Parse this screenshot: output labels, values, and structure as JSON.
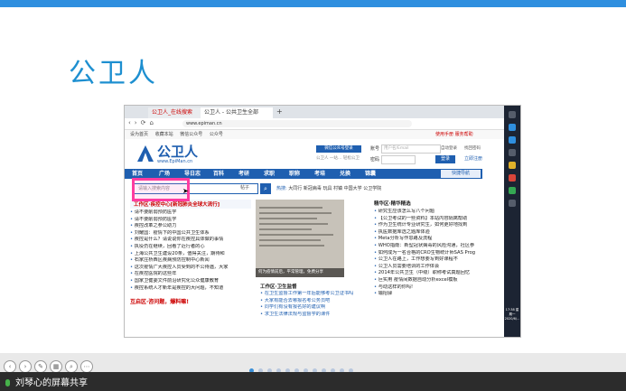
{
  "slide": {
    "title": "公卫人"
  },
  "browser": {
    "tabs": [
      "公卫人_在线搜索",
      "公卫人 - 公共卫生全部"
    ],
    "url": "www.epiman.cn",
    "bookmarks": [
      "设为首页",
      "收藏本站",
      "微信公众号",
      "公众号"
    ],
    "login_hint": "使用手册  服务帮助"
  },
  "site": {
    "logo": "公卫人",
    "logo_sub": "www.EpiMan.cn",
    "wx_login": "微信公众号登录",
    "wx_line": "公卫人 一站… 轻松公卫",
    "account_label": "账号",
    "account_placeholder": "用户名/Email",
    "password_label": "密码",
    "auto_login": "自动登录",
    "forgot": "找回密码",
    "login_btn": "登录",
    "register": "立即注册",
    "nav": [
      "首页",
      "广场",
      "导日志",
      "百科",
      "考研",
      "求职",
      "职称",
      "考培",
      "兑换",
      "锦囊"
    ],
    "quick_nav": "快捷导航",
    "search_placeholder": "请输入搜索内容",
    "search_type": "帖子",
    "hot_label": "热搜:",
    "hot_terms": "大同行  新冠病毒  玩具  村镇  中国大学  公卫学院"
  },
  "left": {
    "title": "工作区·疾控中心[新冠肺炎全球大流行]",
    "items": [
      "请不要削弱预防医学",
      "请不要削弱预防医学",
      "疾控改革之参公助力",
      "刘耀国：疫情下的中国公共卫生体系",
      "疾控是什么？请说说你在疾控具体做的事情",
      "执役仍在继续，回看了近行者的心",
      "上海公共卫生建设20条，值得关注，期待和",
      "石家庄桥西区疾病预防控制中心新闻",
      "这次疫情广大疾控人员受到的不公待遇，大家",
      "在疾控医院的这些年",
      "国家卫健委文件前沿研究化公众健康教育",
      "疾控系统人才新年是疾控的大问题，不知道"
    ],
    "title2": "互启区·咨问题，爆料嘛!"
  },
  "middle": {
    "img_caption": "何为疫情前后，平常管理，免费分享",
    "title": "工作区·卫生监督",
    "items": [
      "在卫生监督工作第一年后能够考公卫证书吗",
      "大家有能否去哪报名考公务员吧",
      "同学们有没有报名好的建议啊",
      "求卫生法律法规与监督学的课件"
    ]
  },
  "right": {
    "title": "精华区·精华精选",
    "items": [
      "研究生应该怎么写八个问题",
      "【公卫考试的一些资料】本站内容隔离帮助",
      "作为卫生统计专业研究生，如何更好地找到",
      "执医数据库选之题库体验",
      "Meta分析写作思路及流程",
      "WHO指南：新型冠状病毒的风险沟通，社区参",
      "如何成为一名合格的CRO生物统计师SAS Prog",
      "公卫人在路上，工作想要写到好课程不",
      "公卫人员需要培训的工作体会",
      "2014年公共卫生（中级）职称考试真题回忆",
      "巨实用 疫情间数据自动分析excel模板",
      "与动这样的你吗!",
      "输招驿"
    ]
  },
  "taskbar": {
    "clock": "17:38 星期一 2020/6/..."
  },
  "bottom": {
    "share_text": "刘琴心的屏幕共享"
  }
}
